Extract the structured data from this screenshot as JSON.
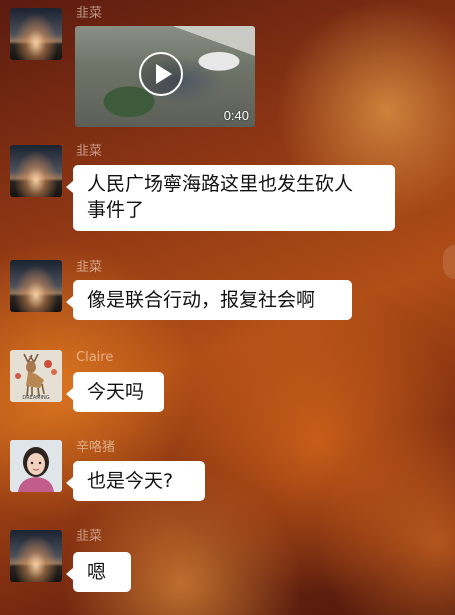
{
  "messages": [
    {
      "sender": "韭菜",
      "avatar_icon": "sunset-avatar",
      "type": "video",
      "duration": "0:40"
    },
    {
      "sender": "韭菜",
      "avatar_icon": "sunset-avatar",
      "type": "text",
      "text_line1": "人民广场寧海路这里也发生砍人",
      "text_line2": "事件了"
    },
    {
      "sender": "韭菜",
      "avatar_icon": "sunset-avatar",
      "type": "text",
      "text": "像是联合行动，报复社会啊"
    },
    {
      "sender": "Claire",
      "avatar_icon": "deer-avatar",
      "avatar_caption": "DREAMING",
      "type": "text",
      "text": "今天吗"
    },
    {
      "sender": "辛咯猪",
      "avatar_icon": "person-avatar",
      "type": "text",
      "text": "也是今天?"
    },
    {
      "sender": "韭菜",
      "avatar_icon": "sunset-avatar",
      "type": "text",
      "text": "嗯"
    }
  ],
  "colors": {
    "bubble": "#ffffff",
    "text": "#111111",
    "background_accent": "#b04e16"
  }
}
